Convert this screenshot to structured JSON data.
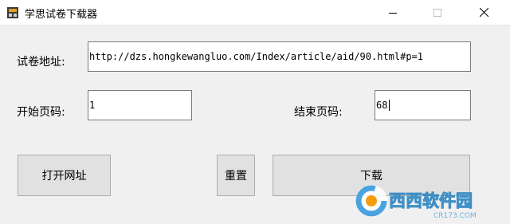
{
  "window": {
    "title": "学思试卷下载器",
    "icon": "downloader-app-icon",
    "controls": [
      "minimize-icon",
      "maximize-icon",
      "close-icon"
    ]
  },
  "form": {
    "url_label": "试卷地址:",
    "url_value": "http://dzs.hongkewangluo.com/Index/article/aid/90.html#p=1",
    "start_label": "开始页码:",
    "start_value": "1",
    "end_label": "结束页码:",
    "end_value": "68"
  },
  "buttons": {
    "open_url": "打开网址",
    "reset": "重置",
    "download": "下载"
  },
  "watermark": {
    "brand": "西西软件园",
    "domain": "CR173.COM"
  },
  "colors": {
    "accent": "#0078d7",
    "button_face": "#e1e1e1",
    "window_bg": "#f0f0f0"
  }
}
